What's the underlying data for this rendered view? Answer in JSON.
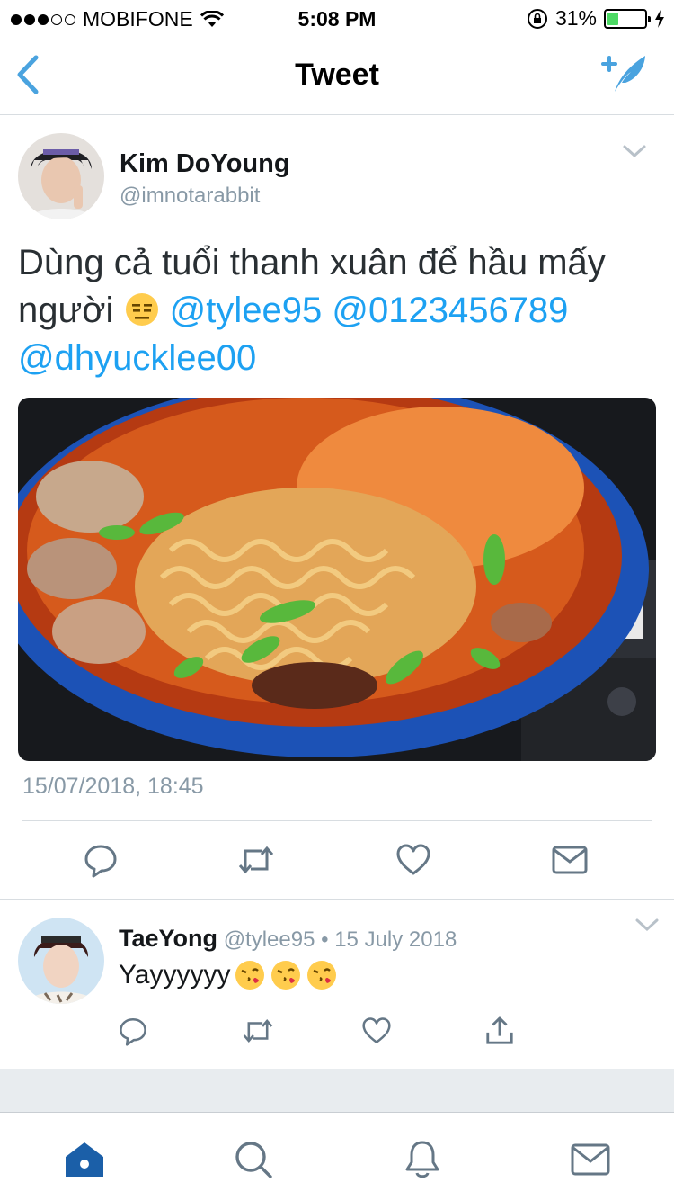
{
  "status_bar": {
    "carrier": "MOBIFONE",
    "time": "5:08 PM",
    "battery": "31%",
    "battery_level": 0.31
  },
  "nav": {
    "title": "Tweet",
    "back_icon": "chevron-left-icon",
    "compose_icon": "compose-tweet-icon"
  },
  "tweet": {
    "author_name": "Kim DoYoung",
    "author_handle": "@imnotarabbit",
    "text": "Dùng cả tuổi thanh xuân để hầu mấy người",
    "emoji": "expressionless-face-emoji",
    "mentions": [
      "@tylee95",
      "@0123456789",
      "@dhyucklee00"
    ],
    "timestamp": "15/07/2018, 18:45",
    "actions": [
      "reply-icon",
      "retweet-icon",
      "like-icon",
      "dm-icon"
    ]
  },
  "reply": {
    "author_name": "TaeYong",
    "handle": "@tylee95",
    "separator": "•",
    "date": "15 July 2018",
    "text": "Yayyyyyy",
    "emojis": [
      "kissing-face-emoji",
      "kissing-face-emoji",
      "kissing-face-emoji"
    ],
    "actions": [
      "reply-icon",
      "retweet-icon",
      "like-icon",
      "share-icon"
    ]
  },
  "tab_bar": {
    "tabs": [
      "home-icon",
      "search-icon",
      "notifications-icon",
      "messages-icon"
    ],
    "active": "home-icon"
  },
  "colors": {
    "accent": "#1da1f2",
    "nav_blue": "#4aa3df",
    "secondary_text": "#8899a6",
    "icon_gray": "#657786",
    "tab_active": "#1b5fa8",
    "battery_green": "#4cd964"
  }
}
